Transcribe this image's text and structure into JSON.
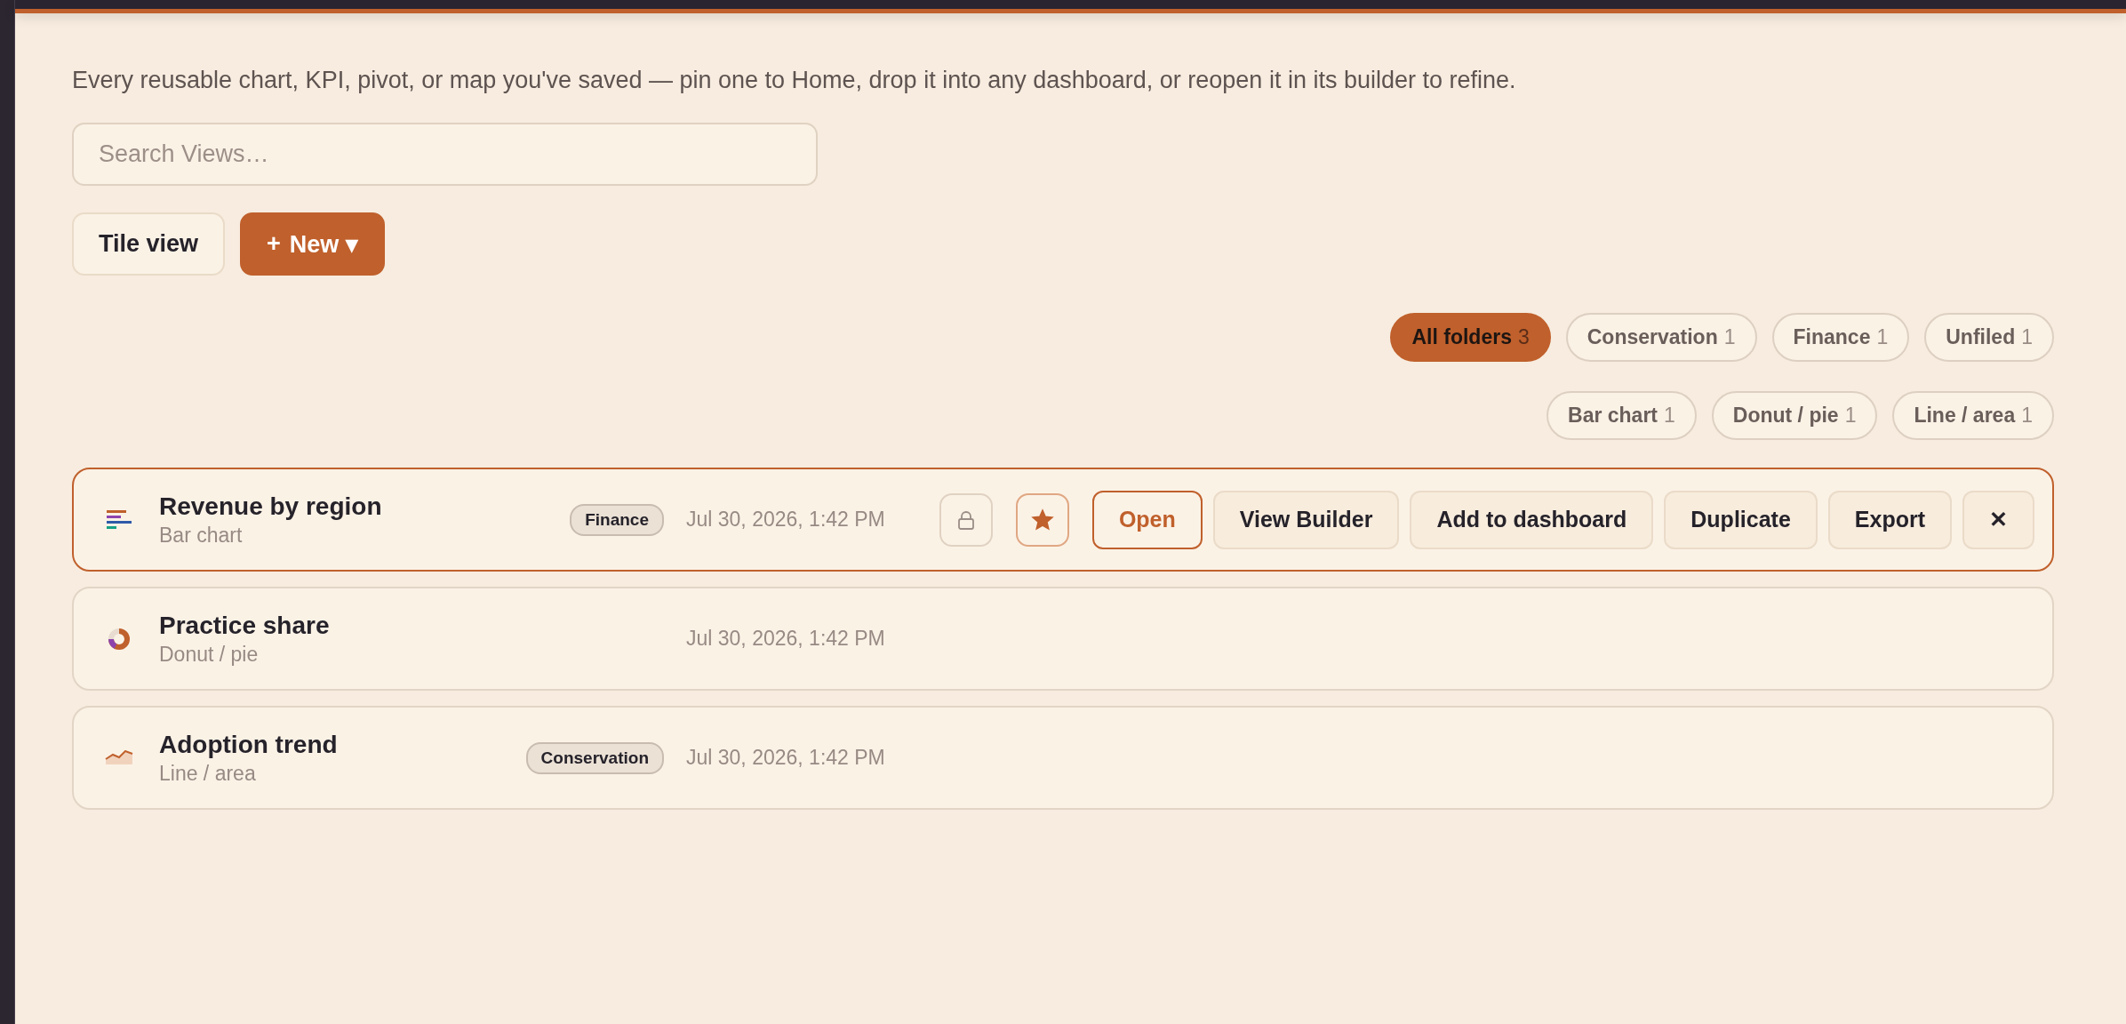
{
  "description": "Every reusable chart, KPI, pivot, or map you've saved — pin one to Home, drop it into any dashboard, or reopen it in its builder to refine.",
  "search": {
    "placeholder": "Search Views…"
  },
  "toolbar": {
    "tile_view": "Tile view",
    "new_button": {
      "icon": "+",
      "label": "New",
      "caret": "▾"
    }
  },
  "folder_filters": [
    {
      "label": "All folders",
      "count": "3",
      "selected": true
    },
    {
      "label": "Conservation",
      "count": "1",
      "selected": false
    },
    {
      "label": "Finance",
      "count": "1",
      "selected": false
    },
    {
      "label": "Unfiled",
      "count": "1",
      "selected": false
    }
  ],
  "type_filters": [
    {
      "label": "Bar chart",
      "count": "1",
      "selected": false
    },
    {
      "label": "Donut / pie",
      "count": "1",
      "selected": false
    },
    {
      "label": "Line / area",
      "count": "1",
      "selected": false
    }
  ],
  "views": [
    {
      "kind": "bar",
      "title": "Revenue by region",
      "type": "Bar chart",
      "tag": "Finance",
      "date": "Jul 30, 2026, 1:42 PM",
      "selected": true,
      "locked": false,
      "starred": true,
      "actions": [
        {
          "kind": "primary",
          "label": "Open"
        },
        {
          "kind": "plain",
          "label": "View Builder"
        },
        {
          "kind": "plain",
          "label": "Add to dashboard"
        },
        {
          "kind": "plain",
          "label": "Duplicate"
        },
        {
          "kind": "plain",
          "label": "Export"
        },
        {
          "kind": "close",
          "label": "✕"
        }
      ]
    },
    {
      "kind": "donut",
      "title": "Practice share",
      "type": "Donut / pie",
      "date": "Jul 30, 2026, 1:42 PM",
      "selected": false
    },
    {
      "kind": "line",
      "title": "Adoption trend",
      "type": "Line / area",
      "tag": "Conservation",
      "date": "Jul 30, 2026, 1:42 PM",
      "selected": false
    }
  ]
}
